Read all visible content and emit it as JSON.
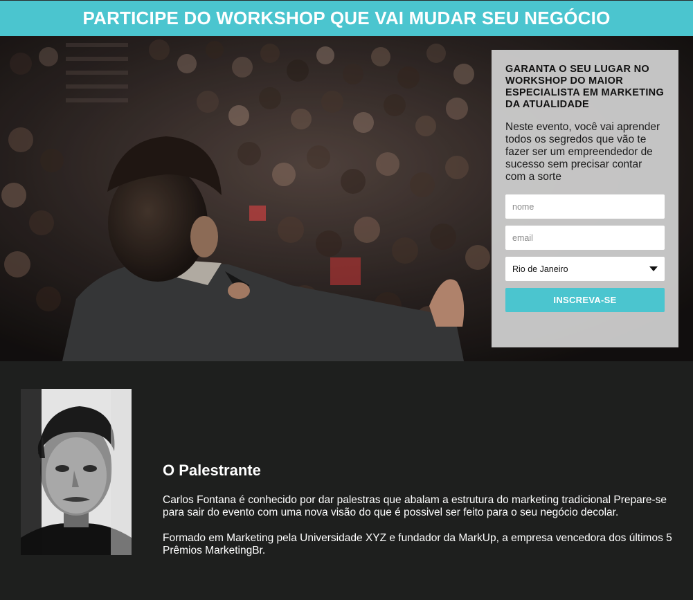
{
  "header": {
    "title": "PARTICIPE DO WORKSHOP QUE VAI MUDAR SEU NEGÓCIO"
  },
  "form": {
    "heading": "GARANTA O SEU LUGAR NO WORKSHOP DO MAIOR ESPECIALISTA EM MARKETING DA ATUALIDADE",
    "description": "Neste evento, você vai aprender todos os segredos que vão te fazer ser um empreendedor de sucesso sem precisar contar com a sorte",
    "name_placeholder": "nome",
    "email_placeholder": "email",
    "city_selected": "Rio de Janeiro",
    "submit_label": "INSCREVA-SE"
  },
  "speaker": {
    "title": "O Palestrante",
    "bio_1": "Carlos Fontana é conhecido por dar palestras que abalam a estrutura do marketing tradicional Prepare-se para sair do evento com uma nova visão do que é possivel ser feito para o seu negócio decolar.",
    "bio_2": "Formado em Marketing pela Universidade XYZ e fundador da MarkUp, a empresa vencedora dos últimos 5 Prêmios MarketingBr."
  },
  "colors": {
    "accent": "#4bc5cf",
    "dark_bg": "#1e1f1e",
    "form_bg": "#cdcdcd"
  }
}
